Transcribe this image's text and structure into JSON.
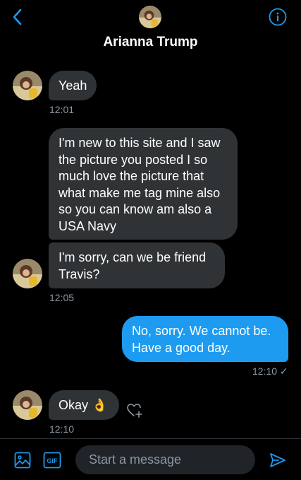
{
  "header": {
    "name": "Arianna Trump"
  },
  "messages": [
    {
      "text": "Yeah",
      "time": "12:01"
    },
    {
      "text": "I'm new to this site and I saw the picture you posted I so much love the picture that what make me tag mine also so you can know am also a USA Navy"
    },
    {
      "text": "I'm sorry, can we be friend Travis?",
      "time": "12:05"
    },
    {
      "text": "No, sorry. We cannot be. Have a good day.",
      "time": "12:10 ✓"
    },
    {
      "text": "Okay 👌",
      "time": "12:10"
    }
  ],
  "composer": {
    "placeholder": "Start a message",
    "gif_label": "GIF"
  },
  "colors": {
    "accent": "#1d9bf0",
    "bubble_incoming": "#2f3336",
    "background": "#000000"
  }
}
